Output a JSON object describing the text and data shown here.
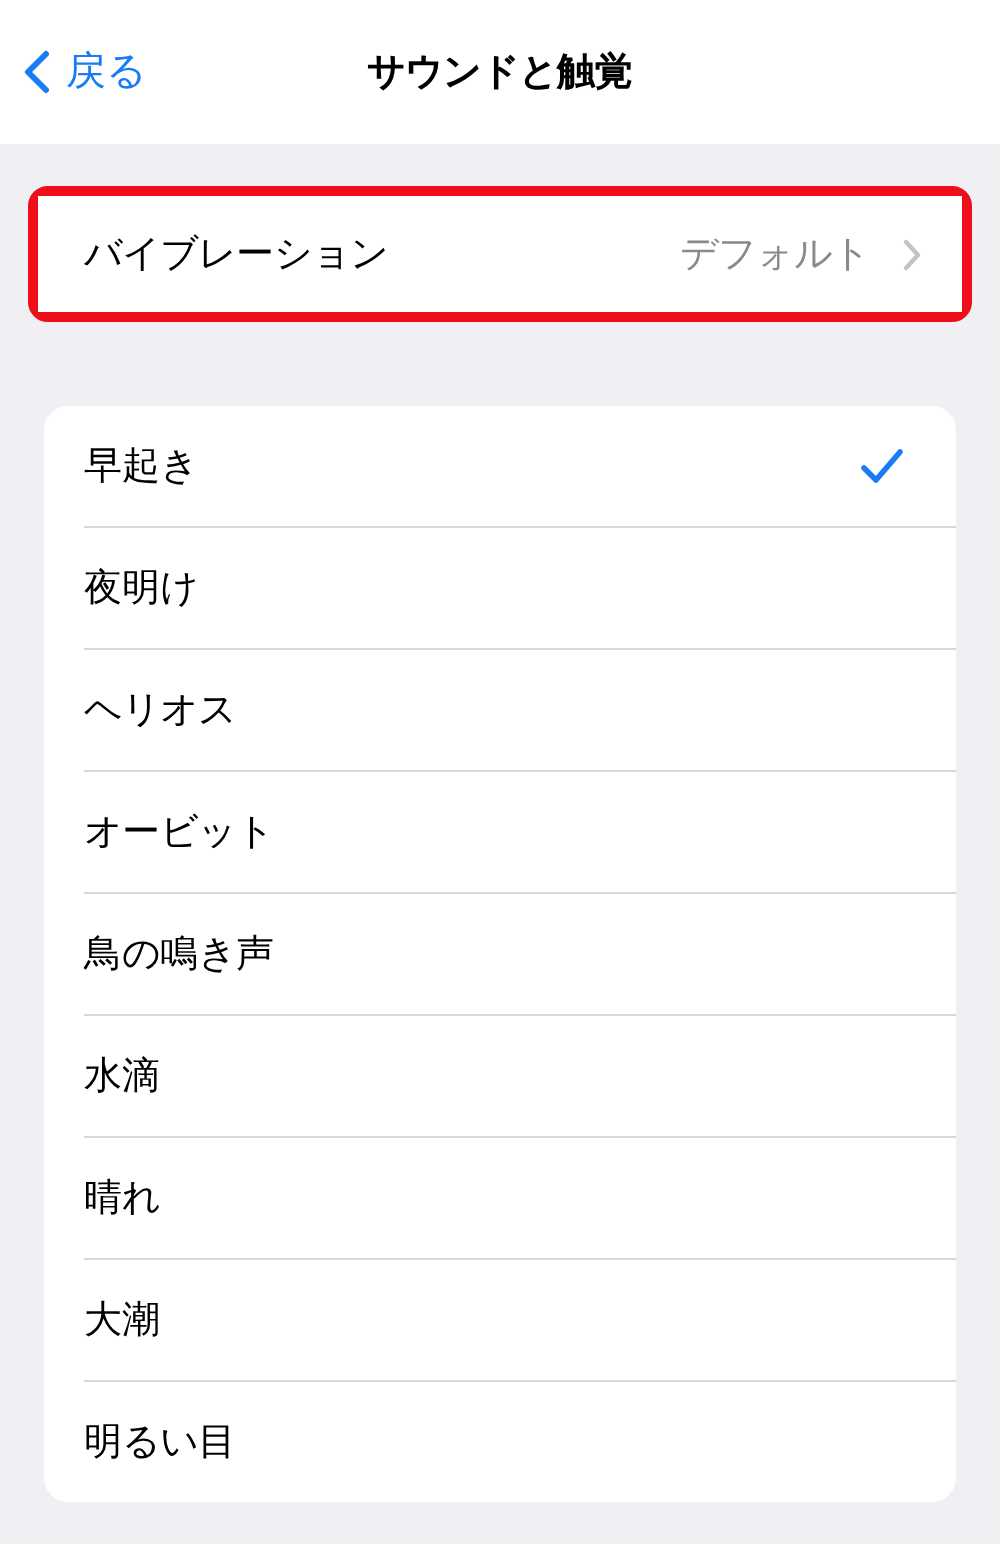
{
  "nav": {
    "back": "戻る",
    "title": "サウンドと触覚"
  },
  "vibration": {
    "label": "バイブレーション",
    "value": "デフォルト",
    "highlighted": true
  },
  "tones": [
    {
      "label": "早起き",
      "selected": true
    },
    {
      "label": "夜明け",
      "selected": false
    },
    {
      "label": "ヘリオス",
      "selected": false
    },
    {
      "label": "オービット",
      "selected": false
    },
    {
      "label": "鳥の鳴き声",
      "selected": false
    },
    {
      "label": "水滴",
      "selected": false
    },
    {
      "label": "晴れ",
      "selected": false
    },
    {
      "label": "大潮",
      "selected": false
    },
    {
      "label": "明るい目",
      "selected": false
    }
  ]
}
